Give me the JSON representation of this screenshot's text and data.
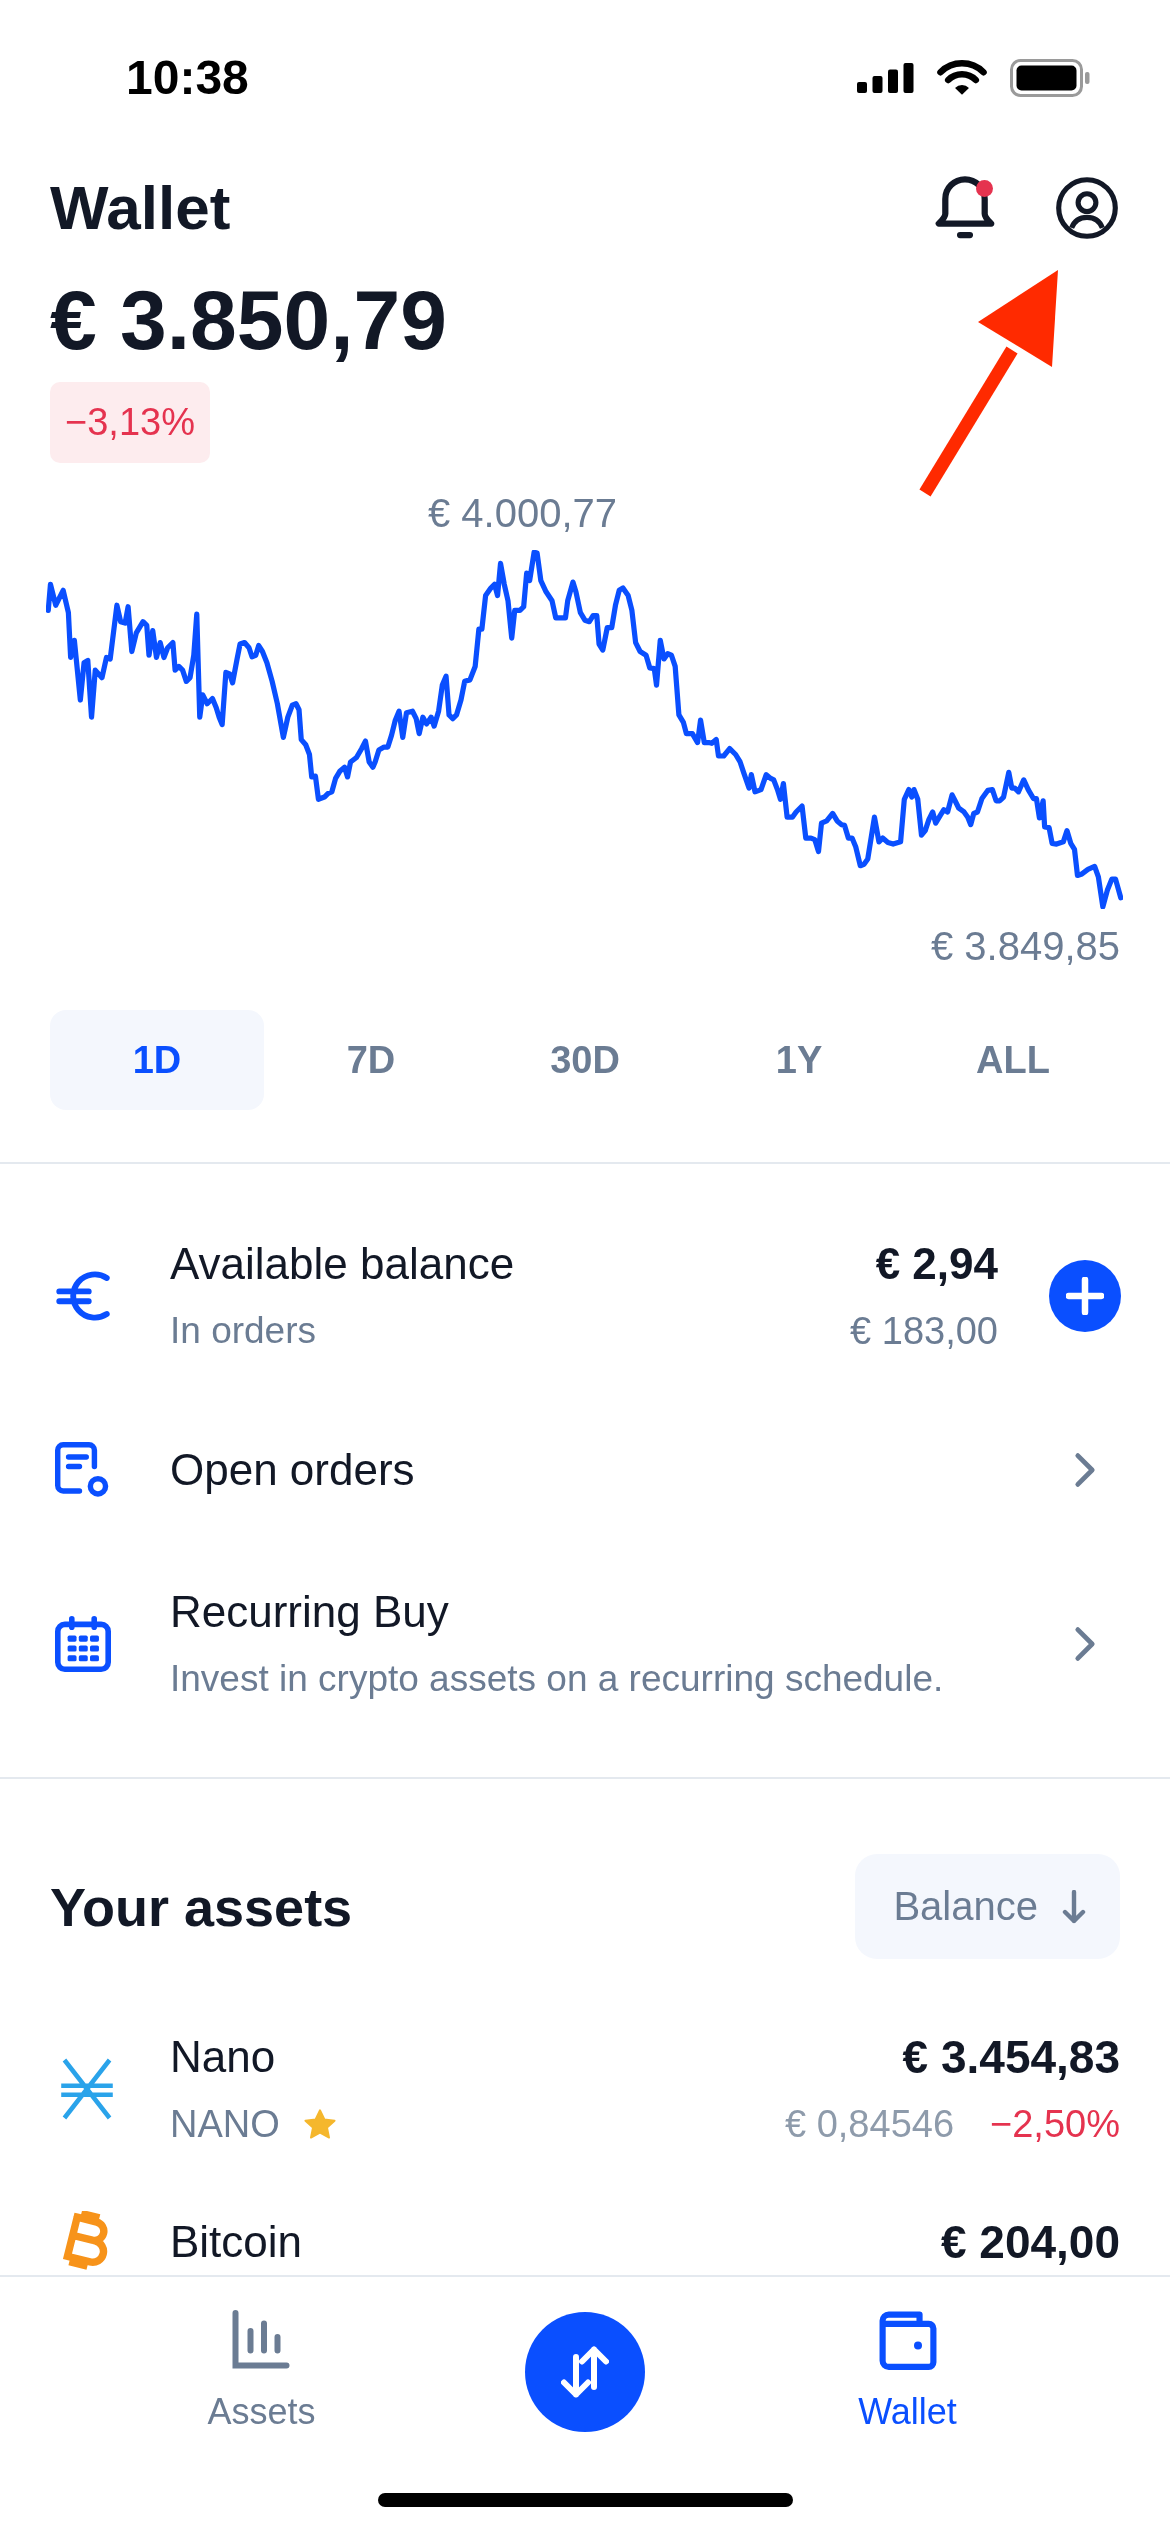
{
  "status_bar": {
    "time": "10:38"
  },
  "header": {
    "title": "Wallet",
    "has_notification": true
  },
  "portfolio": {
    "total": "€ 3.850,79",
    "change": "−3,13%",
    "negative": true
  },
  "chart": {
    "high_label": "€ 4.000,77",
    "low_label": "€ 3.849,85"
  },
  "periods": [
    {
      "label": "1D",
      "selected": true
    },
    {
      "label": "7D",
      "selected": false
    },
    {
      "label": "30D",
      "selected": false
    },
    {
      "label": "1Y",
      "selected": false
    },
    {
      "label": "ALL",
      "selected": false
    }
  ],
  "wallet_rows": [
    {
      "kind": "balance",
      "title": "Available balance",
      "subtitle": "In orders",
      "value": "€ 2,94",
      "subvalue": "€ 183,00"
    },
    {
      "kind": "orders",
      "title": "Open orders"
    },
    {
      "kind": "recurring",
      "title": "Recurring Buy",
      "subtitle": "Invest in crypto assets on a recurring schedule."
    }
  ],
  "assets_section": {
    "title": "Your assets",
    "sort_button": {
      "label": "Balance"
    }
  },
  "assets": [
    {
      "name": "Nano",
      "ticker": "NANO",
      "favorite": true,
      "value": "€ 3.454,83",
      "price": "€ 0,84546",
      "change": "−2,50%",
      "negative": true
    },
    {
      "name": "Bitcoin",
      "value": "€ 204,00"
    }
  ],
  "bottom_nav": [
    {
      "kind": "tab",
      "label": "Assets",
      "selected": false
    },
    {
      "kind": "action"
    },
    {
      "kind": "tab",
      "label": "Wallet",
      "selected": true
    }
  ]
}
